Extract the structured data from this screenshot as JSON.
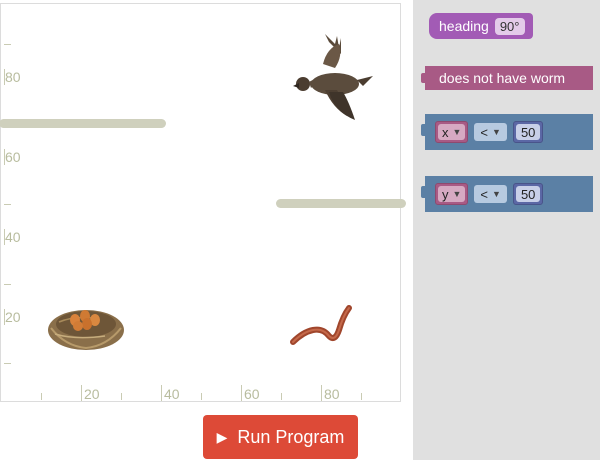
{
  "stage": {
    "y_ticks": [
      "80",
      "60",
      "40",
      "20"
    ],
    "x_ticks": [
      "20",
      "40",
      "60",
      "80"
    ]
  },
  "sprites": {
    "bird": "bird-sprite",
    "worm": "worm-sprite",
    "nest": "nest-sprite"
  },
  "run_button": {
    "label": "Run Program",
    "icon": "play-icon"
  },
  "toolbox": {
    "heading_block": {
      "label": "heading",
      "value": "90°"
    },
    "worm_block": {
      "label": "does not have worm"
    },
    "compare_x": {
      "var": "x",
      "op": "<",
      "value": "50"
    },
    "compare_y": {
      "var": "y",
      "op": "<",
      "value": "50"
    }
  },
  "colors": {
    "run_button": "#dd4a37",
    "heading_block": "#a25bb5",
    "worm_block": "#a85a85",
    "compare_block": "#5b80a5",
    "barrier": "#cfd0bd",
    "toolbox_bg": "#e0e0e0"
  }
}
